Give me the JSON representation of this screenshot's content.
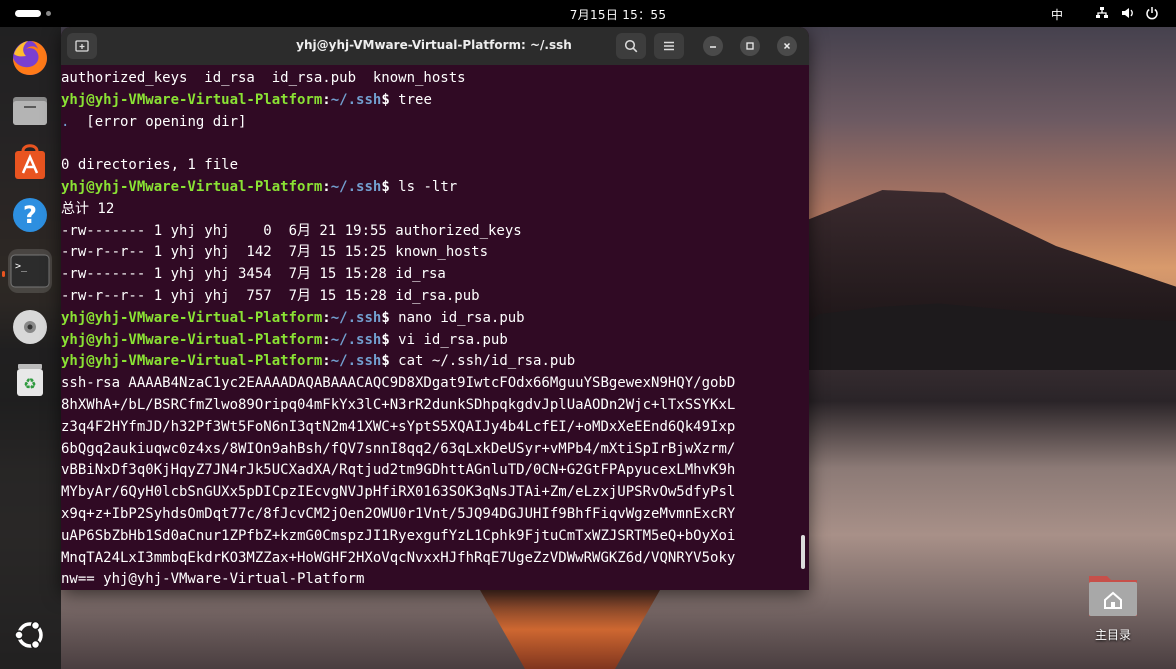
{
  "topbar": {
    "clock": "7月15日  15：55",
    "input_method": "中"
  },
  "dock": {
    "items": [
      {
        "name": "firefox"
      },
      {
        "name": "files"
      },
      {
        "name": "app-center"
      },
      {
        "name": "help"
      },
      {
        "name": "terminal"
      },
      {
        "name": "dvd-drive"
      },
      {
        "name": "trash"
      }
    ]
  },
  "desktop": {
    "home_folder_label": "主目录"
  },
  "terminal": {
    "title": "yhj@yhj-VMware-Virtual-Platform: ~/.ssh",
    "prompt_user": "yhj@yhj-VMware-Virtual-Platform",
    "prompt_sep": ":",
    "prompt_path": "~/.ssh",
    "prompt_dollar": "$ ",
    "lines": [
      {
        "kind": "out",
        "text": "authorized_keys  id_rsa  id_rsa.pub  known_hosts"
      },
      {
        "kind": "cmd",
        "text": "tree"
      },
      {
        "kind": "tree",
        "dot": ".",
        "text": "  [error opening dir]"
      },
      {
        "kind": "out",
        "text": ""
      },
      {
        "kind": "out",
        "text": "0 directories, 1 file"
      },
      {
        "kind": "cmd",
        "text": "ls -ltr"
      },
      {
        "kind": "out",
        "text": "总计 12"
      },
      {
        "kind": "out",
        "text": "-rw------- 1 yhj yhj    0  6月 21 19:55 authorized_keys"
      },
      {
        "kind": "out",
        "text": "-rw-r--r-- 1 yhj yhj  142  7月 15 15:25 known_hosts"
      },
      {
        "kind": "out",
        "text": "-rw------- 1 yhj yhj 3454  7月 15 15:28 id_rsa"
      },
      {
        "kind": "out",
        "text": "-rw-r--r-- 1 yhj yhj  757  7月 15 15:28 id_rsa.pub"
      },
      {
        "kind": "cmd",
        "text": "nano id_rsa.pub"
      },
      {
        "kind": "cmd",
        "text": "vi id_rsa.pub"
      },
      {
        "kind": "cmd",
        "text": "cat ~/.ssh/id_rsa.pub"
      },
      {
        "kind": "out",
        "text": "ssh-rsa AAAAB4NzaC1yc2EAAAADAQABAAACAQC9D8XDgat9IwtcFOdx66MguuYSBgewexN9HQY/gobD"
      },
      {
        "kind": "out",
        "text": "8hXWhA+/bL/BSRCfmZlwo89Oripq04mFkYx3lC+N3rR2dunkSDhpqkgdvJplUaAODn2Wjc+lTxSSYKxL"
      },
      {
        "kind": "out",
        "text": "z3q4F2HYfmJD/h32Pf3Wt5FoN6nI3qtN2m41XWC+sYptS5XQAIJy4b4LcfEI/+oMDxXeEEnd6Qk49Ixp"
      },
      {
        "kind": "out",
        "text": "6bQgq2aukiuqwc0z4xs/8WIOn9ahBsh/fQV7snnI8qq2/63qLxkDeUSyr+vMPb4/mXtiSpIrBjwXzrm/"
      },
      {
        "kind": "out",
        "text": "vBBiNxDf3q0KjHqyZ7JN4rJk5UCXadXA/Rqtjud2tm9GDhttAGnluTD/0CN+G2GtFPApyucexLMhvK9h"
      },
      {
        "kind": "out",
        "text": "MYbyAr/6QyH0lcbSnGUXx5pDICpzIEcvgNVJpHfiRX0163SOK3qNsJTAi+Zm/eLzxjUPSRvOw5dfyPsl"
      },
      {
        "kind": "out",
        "text": "x9q+z+IbP2SyhdsOmDqt77c/8fJcvCM2jOen2OWU0r1Vnt/5JQ94DGJUHIf9BhfFiqvWgzeMvmnExcRY"
      },
      {
        "kind": "out",
        "text": "uAP6SbZbHb1Sd0aCnur1ZPfbZ+kzmG0CmspzJI1RyexgufYzL1Cphk9FjtuCmTxWZJSRTM5eQ+bOyXoi"
      },
      {
        "kind": "out",
        "text": "MnqTA24LxI3mmbqEkdrKO3MZZax+HoWGHF2HXoVqcNvxxHJfhRqE7UgeZzVDWwRWGKZ6d/VQNRYV5oky"
      },
      {
        "kind": "out",
        "text": "nw== yhj@yhj-VMware-Virtual-Platform"
      }
    ]
  }
}
